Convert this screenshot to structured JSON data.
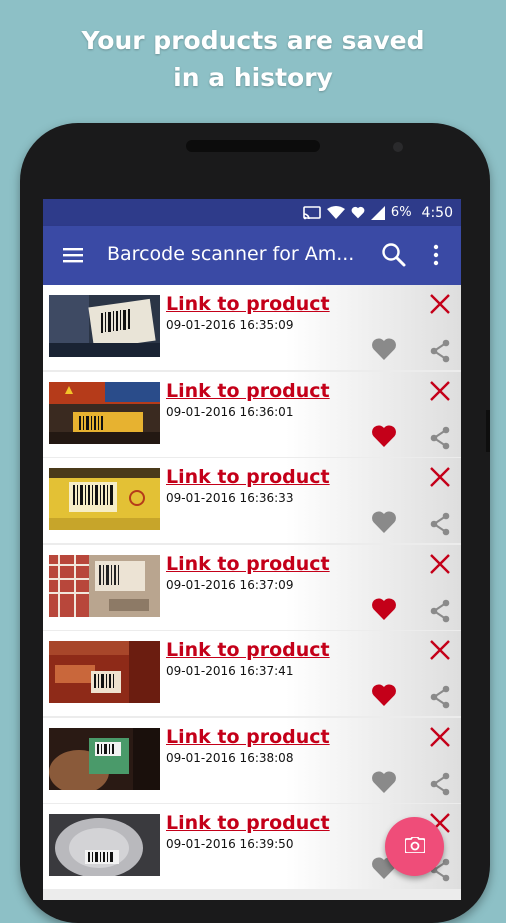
{
  "headline": {
    "line1": "Your products are saved",
    "line2": "in a history"
  },
  "statusbar": {
    "battery": "6%",
    "time": "4:50",
    "icons": [
      "cast-icon",
      "wifi-icon",
      "heart-icon",
      "signal-icon"
    ]
  },
  "appbar": {
    "title": "Barcode scanner for Am...",
    "icons": [
      "menu-icon",
      "search-icon",
      "more-vert-icon"
    ]
  },
  "colors": {
    "appbar": "#3a4aa5",
    "statusbar": "#2e3b8a",
    "link": "#c40019",
    "favorite": "#c40019",
    "fab": "#ef4d79",
    "background": "#8dc0c6"
  },
  "history": [
    {
      "link_label": "Link to product",
      "date": "09-01-2016 16:35:09",
      "favorite": false
    },
    {
      "link_label": "Link to product",
      "date": "09-01-2016 16:36:01",
      "favorite": true
    },
    {
      "link_label": "Link to product",
      "date": "09-01-2016 16:36:33",
      "favorite": false
    },
    {
      "link_label": "Link to product",
      "date": "09-01-2016 16:37:09",
      "favorite": true
    },
    {
      "link_label": "Link to product",
      "date": "09-01-2016 16:37:41",
      "favorite": true
    },
    {
      "link_label": "Link to product",
      "date": "09-01-2016 16:38:08",
      "favorite": false
    },
    {
      "link_label": "Link to product",
      "date": "09-01-2016 16:39:50",
      "favorite": false
    }
  ],
  "fab": {
    "icon": "camera-icon"
  }
}
